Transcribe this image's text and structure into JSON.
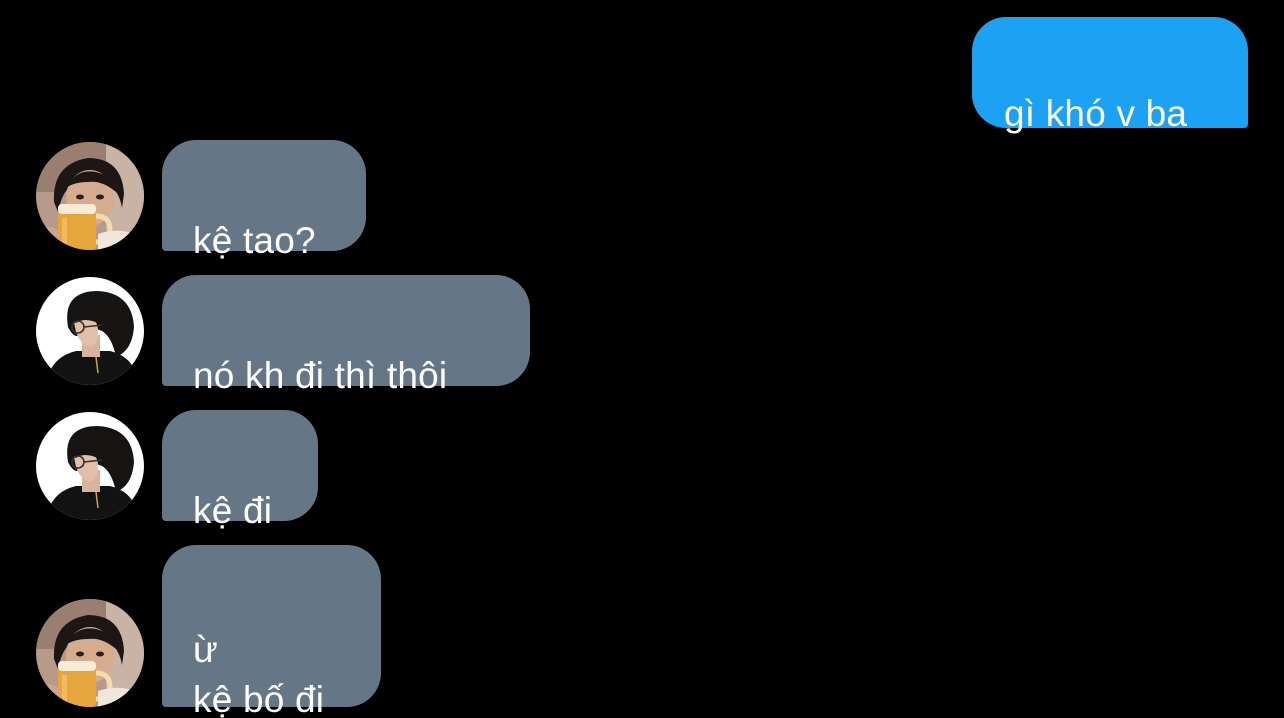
{
  "messages": [
    {
      "direction": "outgoing",
      "text": "gì khó v ba"
    },
    {
      "direction": "incoming",
      "sender": "beer-drinker",
      "text": "kệ tao?"
    },
    {
      "direction": "incoming",
      "sender": "profile-boy",
      "text": "nó kh đi thì thôi"
    },
    {
      "direction": "incoming",
      "sender": "profile-boy",
      "text": "kệ đi"
    },
    {
      "direction": "incoming",
      "sender": "beer-drinker",
      "text": "ừ\nkệ bố đi"
    }
  ],
  "colors": {
    "background": "#000000",
    "outgoing_bubble": "#1da1f2",
    "incoming_bubble": "#657786",
    "text": "#ffffff"
  },
  "icons": {
    "avatar_1": "person-drinking-beer-avatar",
    "avatar_2": "person-profile-glasses-avatar"
  }
}
